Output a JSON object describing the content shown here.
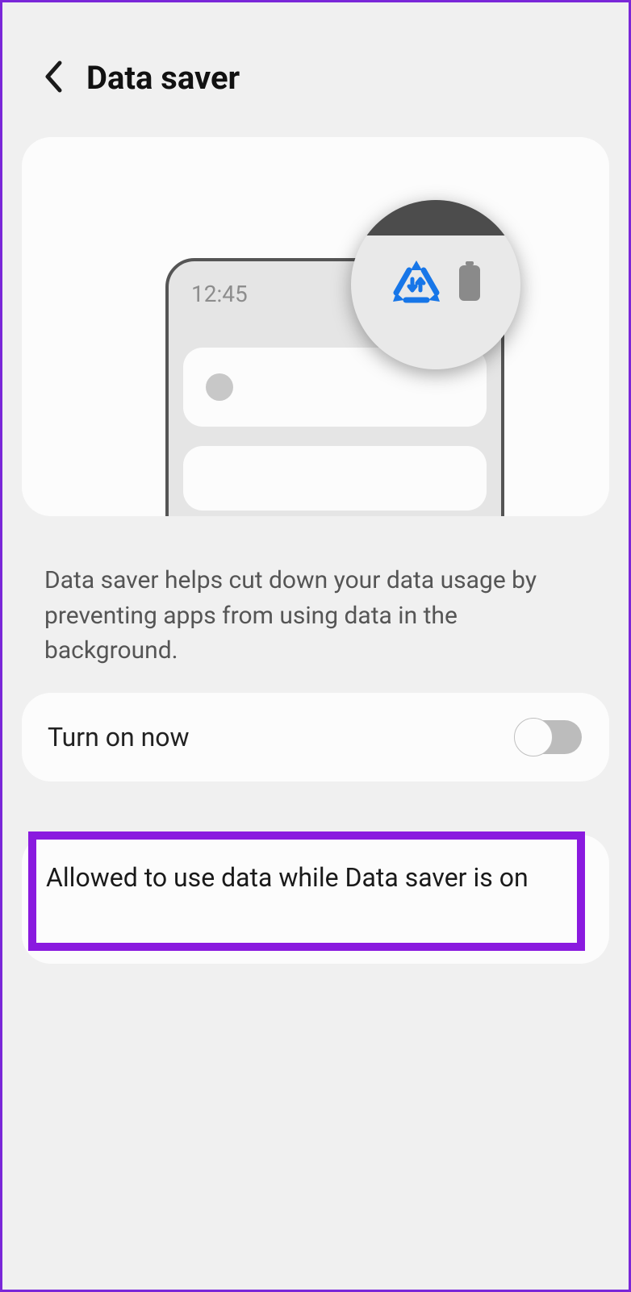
{
  "header": {
    "title": "Data saver"
  },
  "illustration": {
    "time": "12:45"
  },
  "description": "Data saver helps cut down your data usage by preventing apps from using data in the background.",
  "toggle": {
    "label": "Turn on now",
    "state": "off"
  },
  "allowed": {
    "label": "Allowed to use data while Data saver is on"
  }
}
